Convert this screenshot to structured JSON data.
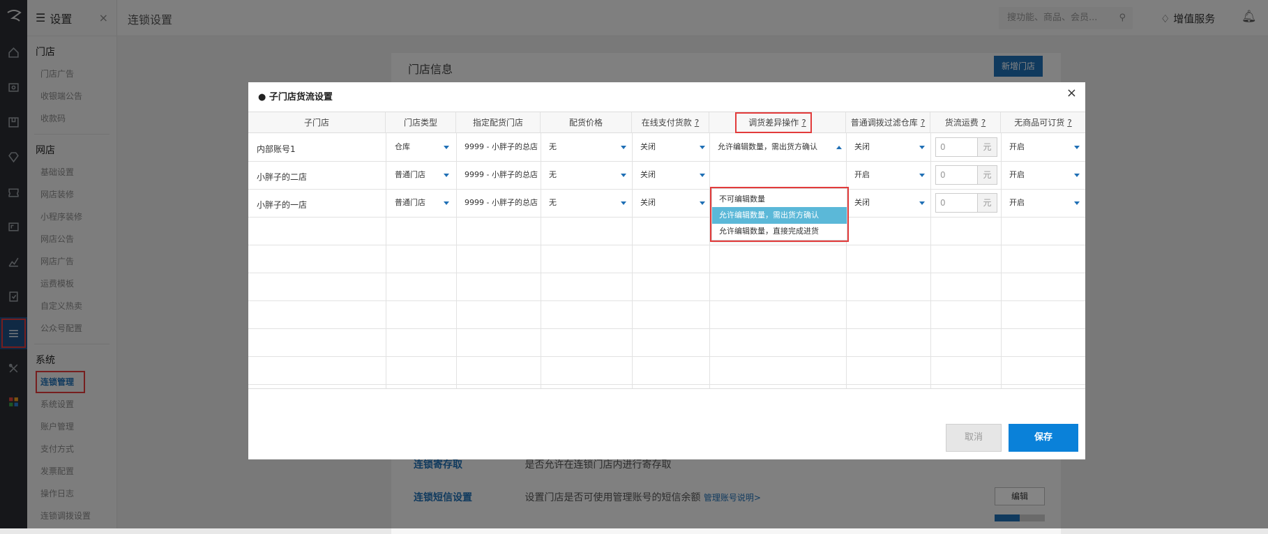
{
  "topbar": {
    "title": "连锁设置",
    "search_placeholder": "搜功能、商品、会员...",
    "value_added": "增值服务"
  },
  "subnav": {
    "header": "设置",
    "groups": [
      {
        "title": "门店",
        "items": [
          "门店广告",
          "收银端公告",
          "收款码"
        ]
      },
      {
        "title": "网店",
        "items": [
          "基础设置",
          "网店装修",
          "小程序装修",
          "网店公告",
          "网店广告",
          "运费模板",
          "自定义热卖",
          "公众号配置"
        ]
      },
      {
        "title": "系统",
        "items": [
          "连锁管理",
          "系统设置",
          "账户管理",
          "支付方式",
          "发票配置",
          "操作日志",
          "连锁调拨设置"
        ]
      }
    ]
  },
  "background": {
    "store_info_title": "门店信息",
    "new_store_button": "新增门店",
    "rows": [
      {
        "label": "连锁寄存取",
        "desc": "是否允许在连锁门店内进行寄存取",
        "link": ""
      },
      {
        "label": "连锁短信设置",
        "desc": "设置门店是否可使用管理账号的短信余额",
        "link": "管理账号说明>",
        "button": "编辑"
      }
    ]
  },
  "modal": {
    "title": "● 子门店货流设置",
    "close": "×",
    "columns": [
      "子门店",
      "门店类型",
      "指定配货门店",
      "配货价格",
      "在线支付货款",
      "调货差异操作",
      "普通调拨过滤仓库",
      "货流运费",
      "无商品可订货"
    ],
    "question_mark": "?",
    "rows": [
      {
        "store": "内部账号1",
        "type": "仓库",
        "dist_store": "9999 - 小胖子的总店",
        "price": "无",
        "online_pay": "关闭",
        "diff_op": "允许编辑数量，需出货方确认",
        "filter_wh": "关闭",
        "freight": "0",
        "unit": "元",
        "order": "开启"
      },
      {
        "store": "小胖子的二店",
        "type": "普通门店",
        "dist_store": "9999 - 小胖子的总店",
        "price": "无",
        "online_pay": "关闭",
        "diff_op": "",
        "filter_wh": "开启",
        "freight": "0",
        "unit": "元",
        "order": "开启"
      },
      {
        "store": "小胖子的一店",
        "type": "普通门店",
        "dist_store": "9999 - 小胖子的总店",
        "price": "无",
        "online_pay": "关闭",
        "diff_op": "",
        "filter_wh": "关闭",
        "freight": "0",
        "unit": "元",
        "order": "开启"
      }
    ],
    "dropdown_options": [
      "不可编辑数量",
      "允许编辑数量，需出货方确认",
      "允许编辑数量，直接完成进货"
    ],
    "cancel": "取消",
    "save": "保存"
  },
  "colors": {
    "accent": "#1f6fb5",
    "save": "#0a81d9",
    "highlight": "#e23b3b",
    "option_selected": "#5bb8d8"
  }
}
